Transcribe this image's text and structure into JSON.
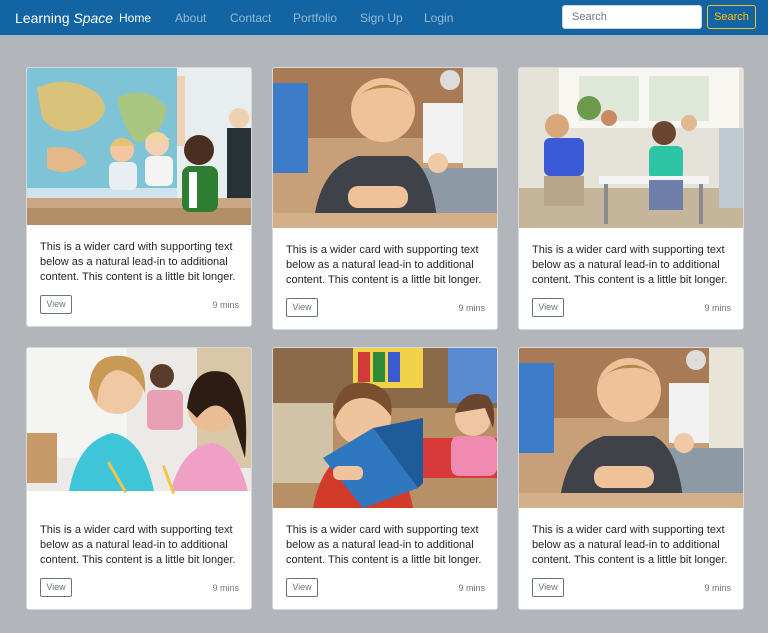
{
  "navbar": {
    "brand_plain": "Learning",
    "brand_italic": "Space",
    "links": [
      "Home",
      "About",
      "Contact",
      "Portfolio",
      "Sign Up",
      "Login"
    ],
    "active_link": "Home",
    "search_placeholder": "Search",
    "search_button": "Search"
  },
  "colors": {
    "navbar": "#1264a3",
    "page_background": "#b2b5ba",
    "search_button_outline": "#ffc107"
  },
  "cards": [
    {
      "image": "classroom-raised-hands-photo",
      "text": "This is a wider card with supporting text below as a natural lead-in to additional content. This content is a little bit longer.",
      "button": "View",
      "time": "9 mins"
    },
    {
      "image": "smiling-boy-at-desk-photo",
      "text": "This is a wider card with supporting text below as a natural lead-in to additional content. This content is a little bit longer.",
      "button": "View",
      "time": "9 mins"
    },
    {
      "image": "students-writing-at-desks-photo",
      "text": "This is a wider card with supporting text below as a natural lead-in to additional content. This content is a little bit longer.",
      "button": "View",
      "time": "9 mins"
    },
    {
      "image": "two-girls-writing-photo",
      "text": "This is a wider card with supporting text below as a natural lead-in to additional content. This content is a little bit longer.",
      "button": "View",
      "time": "9 mins"
    },
    {
      "image": "boy-reading-book-photo",
      "text": "This is a wider card with supporting text below as a natural lead-in to additional content. This content is a little bit longer.",
      "button": "View",
      "time": "9 mins"
    },
    {
      "image": "smiling-boy-at-desk-photo",
      "text": "This is a wider card with supporting text below as a natural lead-in to additional content. This content is a little bit longer.",
      "button": "View",
      "time": "9 mins"
    }
  ]
}
